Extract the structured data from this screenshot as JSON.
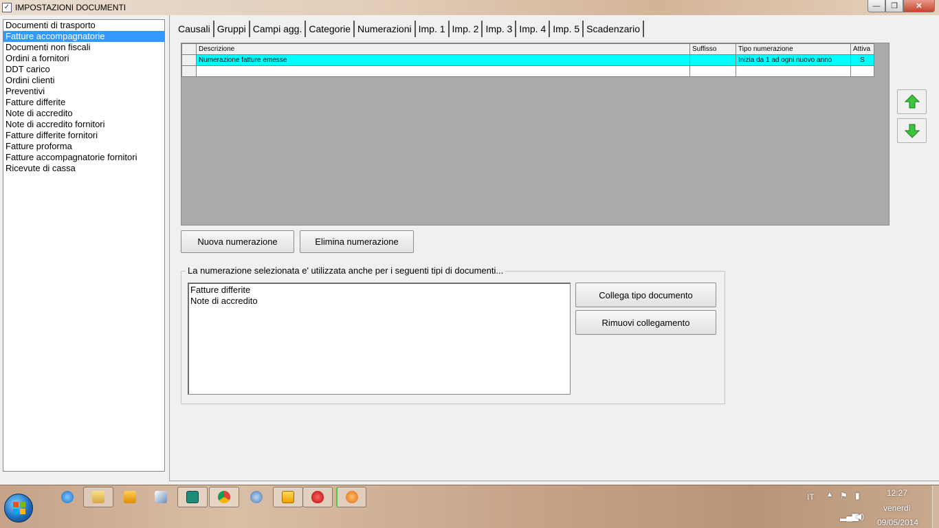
{
  "window": {
    "title": "IMPOSTAZIONI DOCUMENTI",
    "controls": {
      "minimize": "—",
      "maximize": "❐",
      "close": "✕"
    }
  },
  "doc_types": [
    "Documenti di trasporto",
    "Fatture accompagnatorie",
    "Documenti non fiscali",
    "Ordini a fornitori",
    "DDT carico",
    "Ordini clienti",
    "Preventivi",
    "Fatture differite",
    "Note di accredito",
    "Note di accredito fornitori",
    "Fatture differite fornitori",
    "Fatture proforma",
    "Fatture accompagnatorie fornitori",
    "Ricevute di cassa"
  ],
  "selected_doc_type": "Fatture accompagnatorie",
  "tabs": [
    "Causali",
    "Gruppi",
    "Campi agg.",
    "Categorie",
    "Numerazioni",
    "Imp. 1",
    "Imp. 2",
    "Imp. 3",
    "Imp. 4",
    "Imp. 5",
    "Scadenzario"
  ],
  "active_tab": "Numerazioni",
  "grid": {
    "columns": [
      "Descrizione",
      "Suffisso",
      "Tipo numerazione",
      "Attiva"
    ],
    "rows": [
      [
        "Numerazione fatture emesse",
        "",
        "Inizia da 1 ad ogni nuovo anno",
        "S"
      ],
      [
        "",
        "",
        "",
        ""
      ]
    ]
  },
  "buttons": {
    "new_numbering": "Nuova numerazione",
    "delete_numbering": "Elimina numerazione",
    "link_doc_type": "Collega tipo documento",
    "remove_link": "Rimuovi collegamento"
  },
  "linked_group": {
    "legend": "La numerazione selezionata e' utilizzata anche per i seguenti tipi di documenti...",
    "items": [
      "Fatture differite",
      "Note di accredito"
    ]
  },
  "colors": {
    "selection": "#3399ff",
    "grid_selected_row": "#00ffff",
    "arrow_green": "#3cc43c"
  },
  "taskbar": {
    "icons": [
      "ie-icon",
      "explorer-icon",
      "media-player-icon",
      "pen-icon",
      "publisher-icon",
      "chrome-icon",
      "network-icon",
      "outlook-icon",
      "strawberry-icon",
      "app-icon"
    ],
    "language": "IT",
    "time": "12:27",
    "day": "venerdì",
    "date": "09/05/2014"
  }
}
